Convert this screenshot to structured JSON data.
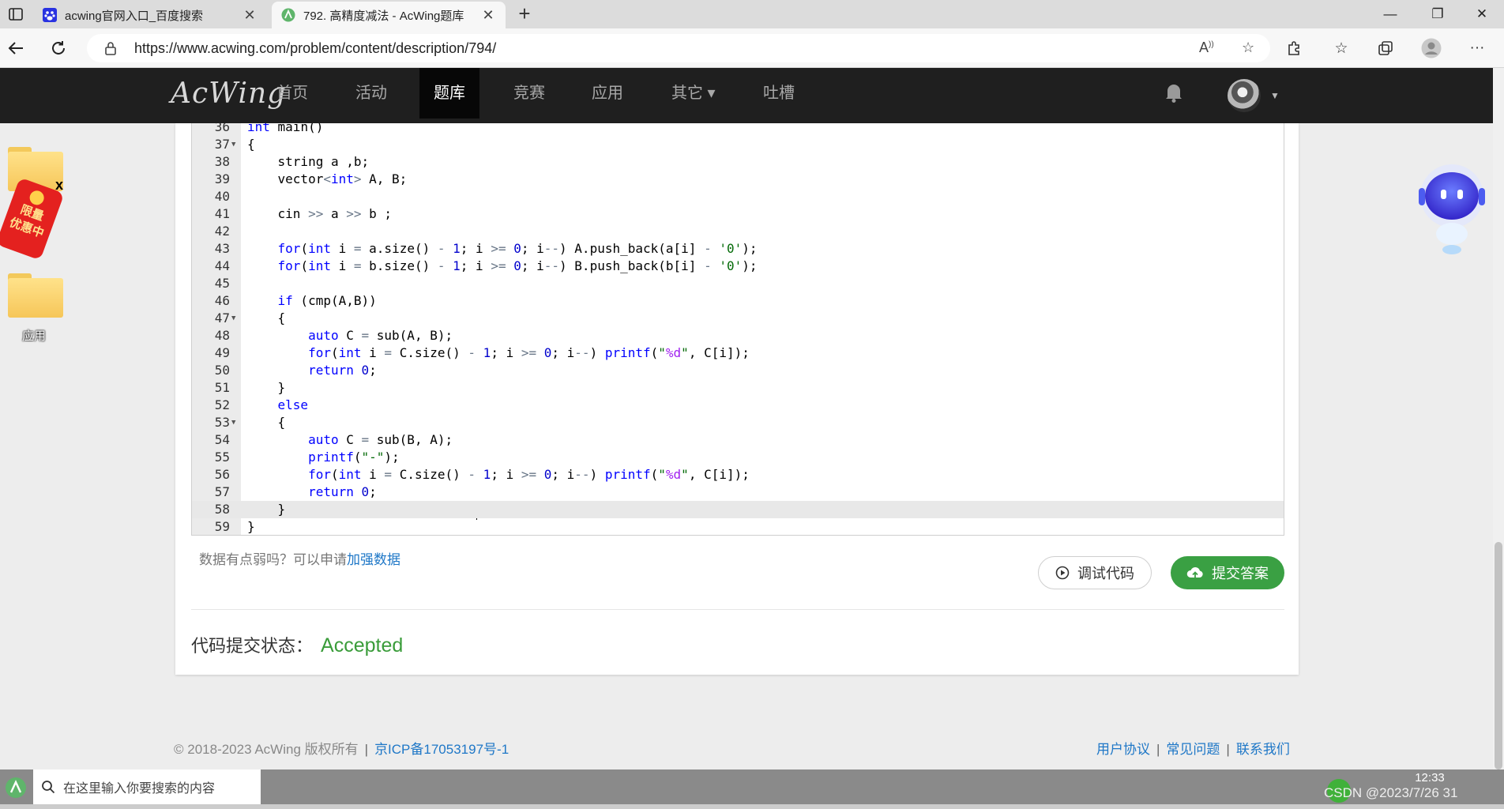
{
  "browser": {
    "tabs": [
      {
        "title": "acwing官网入口_百度搜索",
        "active": false,
        "favicon": "baidu-paw-icon"
      },
      {
        "title": "792. 高精度减法 - AcWing题库",
        "active": true,
        "favicon": "acwing-icon"
      }
    ],
    "new_tab": "+",
    "url": "https://www.acwing.com/problem/content/description/794/",
    "controls": {
      "minimize": "—",
      "restore": "❐",
      "close": "✕"
    }
  },
  "site": {
    "logo": "AcWing",
    "nav": [
      {
        "label": "首页",
        "active": false
      },
      {
        "label": "活动",
        "active": false
      },
      {
        "label": "题库",
        "active": true
      },
      {
        "label": "竞赛",
        "active": false
      },
      {
        "label": "应用",
        "active": false
      },
      {
        "label": "其它 ▾",
        "active": false
      },
      {
        "label": "吐槽",
        "active": false
      }
    ]
  },
  "desktop": {
    "red_packet": {
      "line1": "限量",
      "line2": "优惠中",
      "close": "x"
    },
    "folder_label": "应用"
  },
  "editor": {
    "lines": [
      {
        "n": "36",
        "fold": false,
        "html": "<span class=\"kw\">int</span> main()"
      },
      {
        "n": "37",
        "fold": true,
        "html": "{"
      },
      {
        "n": "38",
        "fold": false,
        "html": "    string a ,b;"
      },
      {
        "n": "39",
        "fold": false,
        "html": "    vector<span class=\"op\">&lt;</span><span class=\"kw\">int</span><span class=\"op\">&gt;</span> A, B;"
      },
      {
        "n": "40",
        "fold": false,
        "html": ""
      },
      {
        "n": "41",
        "fold": false,
        "html": "    cin <span class=\"op\">&gt;&gt;</span> a <span class=\"op\">&gt;&gt;</span> b ;"
      },
      {
        "n": "42",
        "fold": false,
        "html": ""
      },
      {
        "n": "43",
        "fold": false,
        "html": "    <span class=\"kw\">for</span>(<span class=\"kw\">int</span> i <span class=\"op\">=</span> a.size() <span class=\"op\">-</span> <span class=\"num\">1</span>; i <span class=\"op\">&gt;=</span> <span class=\"num\">0</span>; i<span class=\"op\">--</span>) A.push_back(a[i] <span class=\"op\">-</span> <span class=\"str\">'0'</span>);"
      },
      {
        "n": "44",
        "fold": false,
        "html": "    <span class=\"kw\">for</span>(<span class=\"kw\">int</span> i <span class=\"op\">=</span> b.size() <span class=\"op\">-</span> <span class=\"num\">1</span>; i <span class=\"op\">&gt;=</span> <span class=\"num\">0</span>; i<span class=\"op\">--</span>) B.push_back(b[i] <span class=\"op\">-</span> <span class=\"str\">'0'</span>);"
      },
      {
        "n": "45",
        "fold": false,
        "html": ""
      },
      {
        "n": "46",
        "fold": false,
        "html": "    <span class=\"kw\">if</span> (cmp(A,B))"
      },
      {
        "n": "47",
        "fold": true,
        "html": "    {"
      },
      {
        "n": "48",
        "fold": false,
        "html": "        <span class=\"kw\">auto</span> C <span class=\"op\">=</span> sub(A, B);"
      },
      {
        "n": "49",
        "fold": false,
        "html": "        <span class=\"kw\">for</span>(<span class=\"kw\">int</span> i <span class=\"op\">=</span> C.size() <span class=\"op\">-</span> <span class=\"num\">1</span>; i <span class=\"op\">&gt;=</span> <span class=\"num\">0</span>; i<span class=\"op\">--</span>) <span class=\"kw\">printf</span>(<span class=\"str\">\"<span class=\"fmt\">%d</span>\"</span>, C[i]);"
      },
      {
        "n": "50",
        "fold": false,
        "html": "        <span class=\"kw\">return</span> <span class=\"num\">0</span>;"
      },
      {
        "n": "51",
        "fold": false,
        "html": "    }"
      },
      {
        "n": "52",
        "fold": false,
        "html": "    <span class=\"kw\">else</span>"
      },
      {
        "n": "53",
        "fold": true,
        "html": "    {"
      },
      {
        "n": "54",
        "fold": false,
        "html": "        <span class=\"kw\">auto</span> C <span class=\"op\">=</span> sub(B, A);"
      },
      {
        "n": "55",
        "fold": false,
        "html": "        <span class=\"kw\">printf</span>(<span class=\"str\">\"-\"</span>);"
      },
      {
        "n": "56",
        "fold": false,
        "html": "        <span class=\"kw\">for</span>(<span class=\"kw\">int</span> i <span class=\"op\">=</span> C.size() <span class=\"op\">-</span> <span class=\"num\">1</span>; i <span class=\"op\">&gt;=</span> <span class=\"num\">0</span>; i<span class=\"op\">--</span>) <span class=\"kw\">printf</span>(<span class=\"str\">\"<span class=\"fmt\">%d</span>\"</span>, C[i]);"
      },
      {
        "n": "57",
        "fold": false,
        "html": "        <span class=\"kw\">return</span> <span class=\"num\">0</span>;"
      },
      {
        "n": "58",
        "fold": false,
        "html": "    }",
        "active": true
      },
      {
        "n": "59",
        "fold": false,
        "html": "}"
      }
    ]
  },
  "submit_area": {
    "hint_prefix": "数据有点弱吗？可以申请",
    "hint_link": "加强数据",
    "debug_label": "调试代码",
    "submit_label": "提交答案",
    "status_label": "代码提交状态：",
    "status_value": "Accepted"
  },
  "footer": {
    "copyright": "© 2018-2023 AcWing 版权所有",
    "icp": "京ICP备17053197号-1",
    "links": [
      "用户协议",
      "常见问题",
      "联系我们"
    ]
  },
  "taskbar": {
    "search_placeholder": "在这里输入你要搜索的内容",
    "time": "12:33",
    "watermark": "CSDN @2023/7/26 31"
  }
}
